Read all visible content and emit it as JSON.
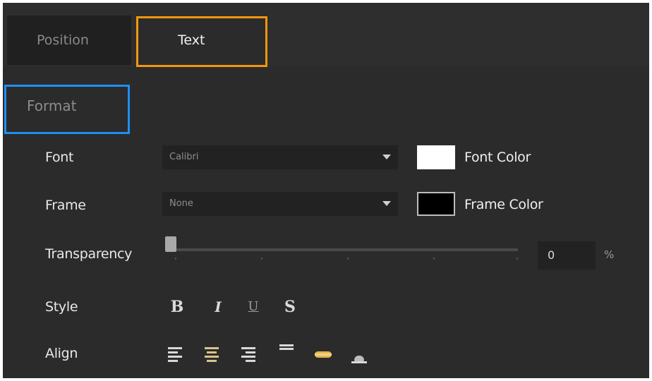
{
  "tabs": [
    {
      "label": "Position",
      "active": false
    },
    {
      "label": "Text",
      "active": true
    }
  ],
  "section": {
    "title": "Format"
  },
  "font": {
    "label": "Font",
    "value": "Calibri",
    "color_label": "Font Color",
    "color": "#ffffff"
  },
  "frame": {
    "label": "Frame",
    "value": "None",
    "color_label": "Frame Color",
    "color": "#000000"
  },
  "transparency": {
    "label": "Transparency",
    "value": "0",
    "unit": "%",
    "level": 0
  },
  "style": {
    "label": "Style",
    "bold": "B",
    "italic": "I",
    "underline": "U",
    "strike": "S"
  },
  "align": {
    "label": "Align",
    "items": [
      "align-left",
      "align-center",
      "align-right",
      "align-top",
      "align-middle",
      "align-bottom"
    ]
  },
  "highlights": {
    "orange": "#f5960d",
    "blue": "#1f8ff5"
  }
}
